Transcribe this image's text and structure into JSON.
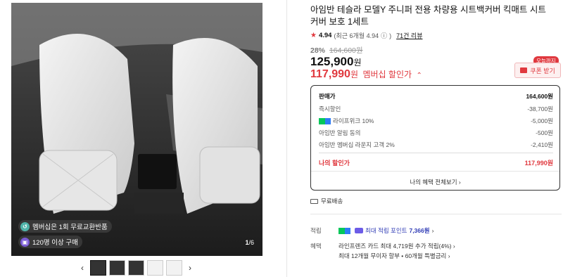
{
  "gallery": {
    "badge_return": "멤버십은 1회 무료교환반품",
    "badge_buyers": "120명 이상 구매",
    "counter_current": "1",
    "counter_total": "/6",
    "prev_arrow": "‹",
    "next_arrow": "›"
  },
  "product": {
    "title": "아임반 테슬라 모델Y 주니퍼 전용 차량용 시트백커버 킥매트 시트커버 보호 1세트",
    "rating": "4.94",
    "rating_detail": "(최근 6개월 4.94",
    "rating_info_icon": "ⓘ",
    "rating_close": ")",
    "review_link": "71건 리뷰",
    "discount_pct": "28%",
    "original_price": "164,600원",
    "price": "125,900",
    "price_unit": "원",
    "member_price": "117,990",
    "member_unit": "원",
    "member_label": "멤버십 할인가",
    "member_chevron": "⌃"
  },
  "coupon": {
    "today_tag": "오늘까지",
    "button_label": "쿠폰 받기"
  },
  "breakdown": {
    "rows": [
      {
        "label": "판매가",
        "value": "164,600원"
      },
      {
        "label": "즉시할인",
        "value": "-38,700원"
      },
      {
        "label": "라이프위크 10%",
        "value": "-5,000원"
      },
      {
        "label": "아임반 알림 동의",
        "value": "-500원"
      },
      {
        "label": "아임반 멤버십 라운지 고객 2%",
        "value": "-2,410원"
      }
    ],
    "mine_label": "나의 할인가",
    "mine_value": "117,990원",
    "detail_link": "나의 혜택 전체보기 ›"
  },
  "shipping": {
    "label": "무료배송"
  },
  "points": {
    "label": "적립",
    "text": "최대 적립 포인트",
    "value": "7,366원",
    "chevron": "›"
  },
  "benefits": {
    "label": "혜택",
    "line1": "라인프렌즈 카드 최대 4,719원 추가 적립(4%) ›",
    "line2": "최대 12개월 무이자 할부 • 60개월 특별금리 ›"
  },
  "colors": {
    "accent_red": "#e0383e",
    "point_blue": "#2f3bb5",
    "naver_green": "#03c75a"
  }
}
